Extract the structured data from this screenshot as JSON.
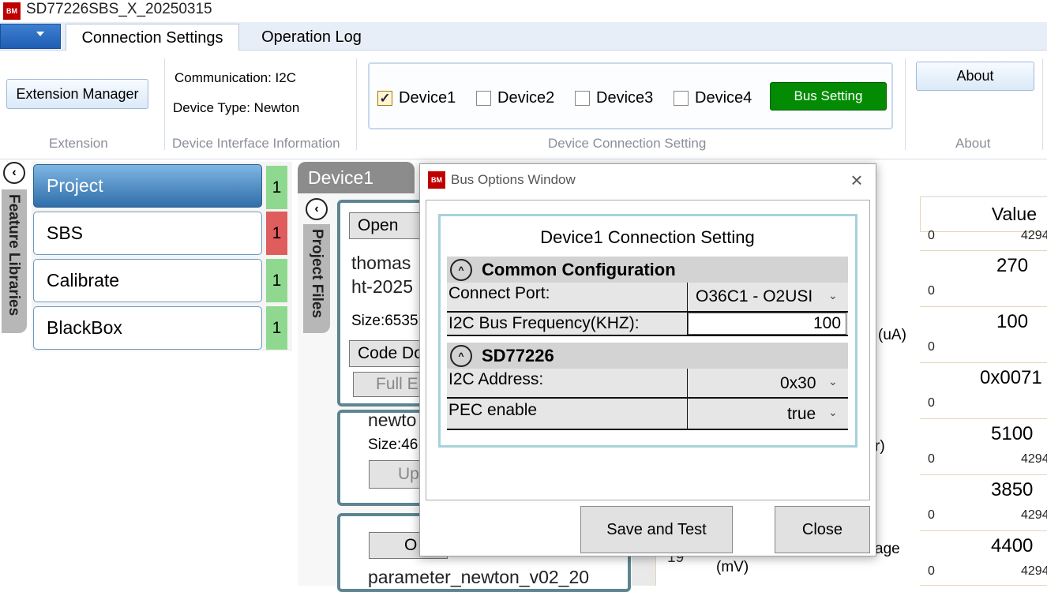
{
  "app": {
    "title": "SD77226SBS_X_20250315",
    "logo_text": "BM"
  },
  "tabs": [
    {
      "label": "Connection Settings",
      "active": true
    },
    {
      "label": "Operation Log",
      "active": false
    }
  ],
  "ribbon": {
    "extension": {
      "button": "Extension Manager",
      "group_label": "Extension"
    },
    "interface": {
      "communication": "Communication: I2C",
      "device_type": "Device Type: Newton",
      "group_label": "Device Interface Information"
    },
    "connection": {
      "devices": [
        {
          "label": "Device1",
          "checked": true
        },
        {
          "label": "Device2",
          "checked": false
        },
        {
          "label": "Device3",
          "checked": false
        },
        {
          "label": "Device4",
          "checked": false
        }
      ],
      "bus_setting": "Bus Setting",
      "group_label": "Device Connection Setting"
    },
    "about": {
      "button": "About",
      "group_label": "About"
    }
  },
  "feature_libraries": {
    "panel_title": "Feature Libraries",
    "items": [
      {
        "label": "Project",
        "count": "1",
        "count_color": "#8fd88f"
      },
      {
        "label": "SBS",
        "count": "1",
        "count_color": "#e05d5d"
      },
      {
        "label": "Calibrate",
        "count": "1",
        "count_color": "#8fd88f"
      },
      {
        "label": "BlackBox",
        "count": "1",
        "count_color": "#8fd88f"
      }
    ]
  },
  "project_files": {
    "panel_title": "Project Files",
    "device_tab": "Device1",
    "card1": {
      "open_btn": "Open",
      "name_line1": "thomas",
      "name_line2": "ht-2025",
      "size": "Size:6535",
      "code_btn": "Code Do",
      "full_btn": "Full E"
    },
    "card2": {
      "name": "newto",
      "size": "Size:46",
      "up_btn": "Up"
    },
    "card3": {
      "open_btn": "O",
      "name": "parameter_newton_v02_20"
    }
  },
  "table": {
    "header_value": "Value",
    "unit_labels": [
      "(uA)",
      "r)",
      "age",
      "(mV)"
    ],
    "row_num": "19",
    "rows": [
      {
        "value": "",
        "min": "0",
        "max": "4294"
      },
      {
        "value": "270",
        "min": "0",
        "max": ""
      },
      {
        "value": "100",
        "min": "0",
        "max": ""
      },
      {
        "value": "0x0071",
        "min": "0",
        "max": ""
      },
      {
        "value": "5100",
        "min": "0",
        "max": "4294"
      },
      {
        "value": "3850",
        "min": "0",
        "max": "4294"
      },
      {
        "value": "4400",
        "min": "0",
        "max": "4294"
      }
    ]
  },
  "dialog": {
    "title": "Bus Options Window",
    "heading": "Device1 Connection Setting",
    "common_section": "Common Configuration",
    "connect_port_label": "Connect Port:",
    "connect_port_value": "O36C1 - O2USI",
    "freq_label": "I2C Bus Frequency(KHZ):",
    "freq_value": "100",
    "device_section": "SD77226",
    "address_label": "I2C Address:",
    "address_value": "0x30",
    "pec_label": "PEC enable",
    "pec_value": "true",
    "save_btn": "Save and Test",
    "close_btn": "Close"
  }
}
